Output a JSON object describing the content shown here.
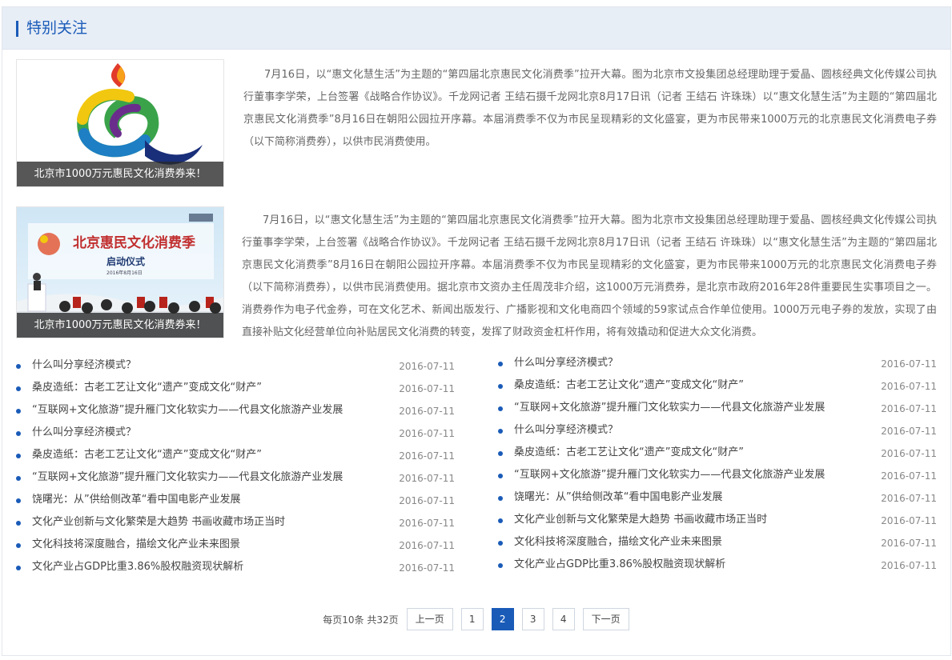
{
  "section": {
    "title": "特别关注"
  },
  "features": [
    {
      "caption": "北京市1000万元惠民文化消费券来！",
      "text": "7月16日，以“惠文化慧生活”为主题的“第四届北京惠民文化消费季”拉开大幕。图为北京市文投集团总经理助理于爱晶、圆核经典文化传媒公司执行董事李学荣，上台签署《战略合作协议》。千龙网记者 王结石摄千龙网北京8月17日讯（记者 王结石 许珠珠）以“惠文化慧生活”为主题的“第四届北京惠民文化消费季”8月16日在朝阳公园拉开序幕。本届消费季不仅为市民呈现精彩的文化盛宴，更为市民带来1000万元的北京惠民文化消费电子券（以下简称消费券），以供市民消费使用。"
    },
    {
      "caption": "北京市1000万元惠民文化消费券来！",
      "banner": {
        "title": "北京惠民文化消费季",
        "subtitle": "启动仪式",
        "date": "2016年8月16日"
      },
      "text": "7月16日，以“惠文化慧生活”为主题的“第四届北京惠民文化消费季”拉开大幕。图为北京市文投集团总经理助理于爱晶、圆核经典文化传媒公司执行董事李学荣，上台签署《战略合作协议》。千龙网记者 王结石摄千龙网北京8月17日讯（记者 王结石 许珠珠）以“惠文化慧生活”为主题的“第四届北京惠民文化消费季”8月16日在朝阳公园拉开序幕。本届消费季不仅为市民呈现精彩的文化盛宴，更为市民带来1000万元的北京惠民文化消费电子券（以下简称消费券），以供市民消费使用。据北京市文资办主任周茂非介绍，这1000万元消费券，是北京市政府2016年28件重要民生实事项目之一。消费券作为电子代金券，可在文化艺术、新闻出版发行、广播影视和文化电商四个领域的59家试点合作单位使用。1000万元电子券的发放，实现了由直接补贴文化经营单位向补贴居民文化消费的转变，发挥了财政资金杠杆作用，将有效撬动和促进大众文化消费。"
    }
  ],
  "news": {
    "left": [
      {
        "title": "什么叫分享经济模式？",
        "date": "2016-07-11"
      },
      {
        "title": "桑皮造纸：古老工艺让文化“遗产”变成文化“财产”",
        "date": "2016-07-11"
      },
      {
        "title": "“互联网+文化旅游”提升雁门文化软实力——代县文化旅游产业发展",
        "date": "2016-07-11"
      },
      {
        "title": "什么叫分享经济模式？",
        "date": "2016-07-11"
      },
      {
        "title": "桑皮造纸：古老工艺让文化“遗产”变成文化“财产”",
        "date": "2016-07-11"
      },
      {
        "title": "“互联网+文化旅游”提升雁门文化软实力——代县文化旅游产业发展",
        "date": "2016-07-11"
      },
      {
        "title": "饶曙光：从”供给侧改革“看中国电影产业发展",
        "date": "2016-07-11"
      },
      {
        "title": "文化产业创新与文化繁荣是大趋势 书画收藏市场正当时",
        "date": "2016-07-11"
      },
      {
        "title": "文化科技将深度融合，描绘文化产业未来图景",
        "date": "2016-07-11"
      },
      {
        "title": "文化产业占GDP比重3.86%股权融资现状解析",
        "date": "2016-07-11"
      }
    ],
    "right": [
      {
        "title": "什么叫分享经济模式？",
        "date": "2016-07-11"
      },
      {
        "title": "桑皮造纸：古老工艺让文化“遗产”变成文化“财产”",
        "date": "2016-07-11"
      },
      {
        "title": "“互联网+文化旅游”提升雁门文化软实力——代县文化旅游产业发展",
        "date": "2016-07-11"
      },
      {
        "title": "什么叫分享经济模式？",
        "date": "2016-07-11"
      },
      {
        "title": "桑皮造纸：古老工艺让文化“遗产”变成文化“财产”",
        "date": "2016-07-11"
      },
      {
        "title": "“互联网+文化旅游”提升雁门文化软实力——代县文化旅游产业发展",
        "date": "2016-07-11"
      },
      {
        "title": "饶曙光：从”供给侧改革“看中国电影产业发展",
        "date": "2016-07-11"
      },
      {
        "title": "文化产业创新与文化繁荣是大趋势 书画收藏市场正当时",
        "date": "2016-07-11"
      },
      {
        "title": "文化科技将深度融合，描绘文化产业未来图景",
        "date": "2016-07-11"
      },
      {
        "title": "文化产业占GDP比重3.86%股权融资现状解析",
        "date": "2016-07-11"
      }
    ]
  },
  "pager": {
    "info": "每页10条 共32页",
    "prev": "上一页",
    "next": "下一页",
    "pages": [
      "1",
      "2",
      "3",
      "4"
    ],
    "current": "2"
  },
  "colors": {
    "accent": "#1a5bb8",
    "header_bg": "#e8eef6"
  }
}
